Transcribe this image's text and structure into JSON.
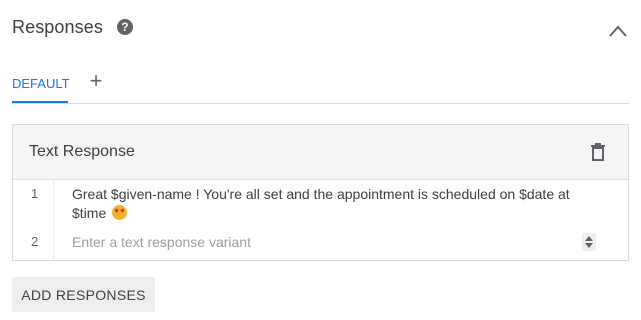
{
  "section": {
    "title": "Responses"
  },
  "tabs": {
    "default_label": "DEFAULT",
    "add_symbol": "+"
  },
  "card": {
    "title": "Text Response",
    "rows": [
      {
        "num": "1",
        "text": "Great $given-name ! You're all set and the appointment is scheduled on $date at $time"
      },
      {
        "num": "2",
        "placeholder": "Enter a text response variant",
        "value": ""
      }
    ]
  },
  "actions": {
    "add_responses_label": "ADD RESPONSES"
  },
  "icons": {
    "help": "help-circle-icon",
    "collapse": "chevron-up-icon",
    "delete": "trash-icon",
    "emoji": "star-struck-emoji-icon"
  },
  "colors": {
    "accent": "#1a73e8",
    "card_header_bg": "#f5f5f5",
    "button_bg": "#eeeeee"
  }
}
